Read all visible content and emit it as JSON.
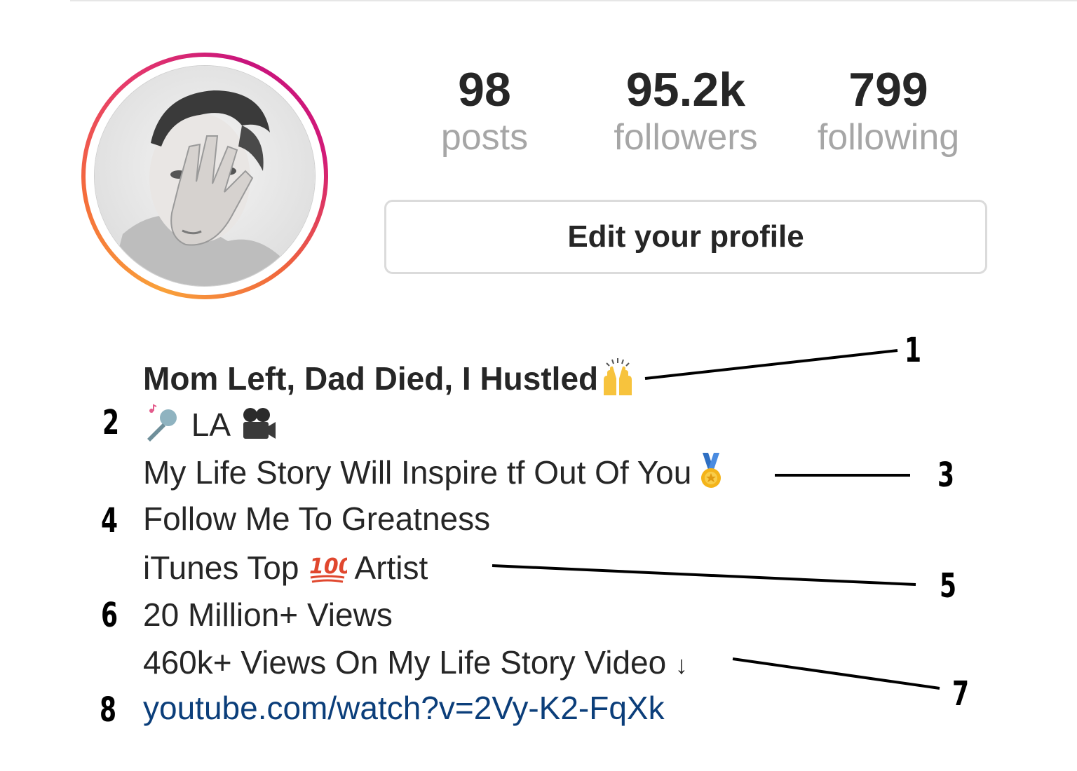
{
  "profile": {
    "stats": [
      {
        "value": "98",
        "label": "posts"
      },
      {
        "value": "95.2k",
        "label": "followers"
      },
      {
        "value": "799",
        "label": "following"
      }
    ],
    "edit_button_label": "Edit your profile"
  },
  "bio": {
    "name": "Mom Left, Dad Died, I Hustled",
    "line2": "LA",
    "line3": "My Life Story Will Inspire tf Out Of You",
    "line4": "Follow Me To Greatness",
    "line5_a": "iTunes Top",
    "line5_b": "Artist",
    "line6": "20 Million+ Views",
    "line7": "460k+ Views On My Life Story Video",
    "line7_arrow": "↓",
    "link": "youtube.com/watch?v=2Vy-K2-FqXk"
  },
  "annotations": [
    "1",
    "2",
    "3",
    "4",
    "5",
    "6",
    "7",
    "8"
  ],
  "colors": {
    "link": "#0b3e7a",
    "stat_label": "#a6a6a6",
    "text": "#262626",
    "ring_start": "#f9a13a",
    "ring_end": "#c8137c"
  },
  "icons": [
    "raised-hands-emoji",
    "microphone-emoji",
    "movie-camera-emoji",
    "medal-emoji",
    "hundred-points-emoji"
  ]
}
